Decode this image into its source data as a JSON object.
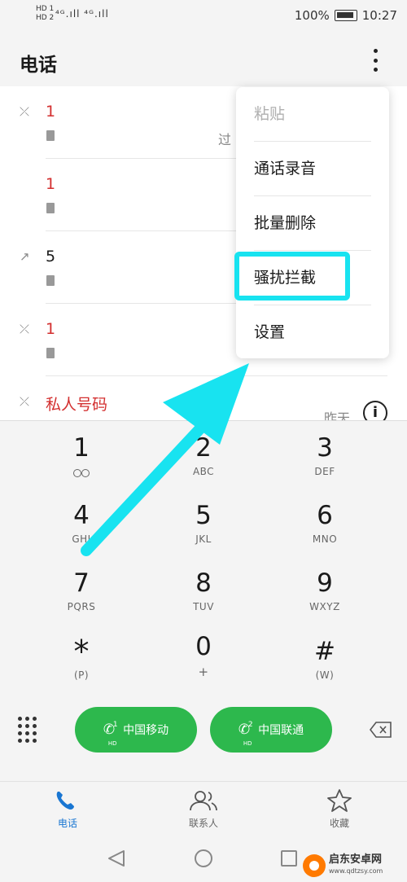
{
  "status_bar": {
    "hd1": "HD 1",
    "hd2": "HD 2",
    "signal": "⁴ᴳ.ıll ⁴ᴳ.ıll",
    "battery_percent": "100%",
    "time": "10:27"
  },
  "header": {
    "title": "电话"
  },
  "call_log": [
    {
      "number": "1",
      "fragment": "过",
      "color": "#d32f2f"
    },
    {
      "number": "1",
      "fragment": "",
      "color": "#d32f2f"
    },
    {
      "number": "5",
      "fragment": "",
      "color": "#1a1a1a"
    },
    {
      "number": "1",
      "fragment": "",
      "color": "#d32f2f"
    },
    {
      "number": "私人号码",
      "date": "昨天",
      "color": "#d32f2f"
    }
  ],
  "menu": {
    "items": [
      "粘贴",
      "通话录音",
      "批量删除",
      "骚扰拦截",
      "设置"
    ],
    "disabled_index": 0,
    "highlight_index": 3,
    "highlight_color": "#18e3f0"
  },
  "dialpad": {
    "keys": [
      {
        "digit": "1",
        "letters": ""
      },
      {
        "digit": "2",
        "letters": "ABC"
      },
      {
        "digit": "3",
        "letters": "DEF"
      },
      {
        "digit": "4",
        "letters": "GHI"
      },
      {
        "digit": "5",
        "letters": "JKL"
      },
      {
        "digit": "6",
        "letters": "MNO"
      },
      {
        "digit": "7",
        "letters": "PQRS"
      },
      {
        "digit": "8",
        "letters": "TUV"
      },
      {
        "digit": "9",
        "letters": "WXYZ"
      },
      {
        "digit": "*",
        "letters": "(P)"
      },
      {
        "digit": "0",
        "letters": "+"
      },
      {
        "digit": "#",
        "letters": "(W)"
      }
    ],
    "call_buttons": [
      {
        "sim": "1",
        "hd": "HD",
        "label": "中国移动"
      },
      {
        "sim": "2",
        "hd": "HD",
        "label": "中国联通"
      }
    ],
    "accent_green": "#2db84d"
  },
  "bottom_nav": {
    "tabs": [
      {
        "label": "电话",
        "active": true
      },
      {
        "label": "联系人",
        "active": false
      },
      {
        "label": "收藏",
        "active": false
      }
    ],
    "active_color": "#1976d2"
  },
  "watermark": {
    "name": "启东安卓网",
    "url": "www.qdtzsy.com"
  },
  "arrow_color": "#18e3f0"
}
